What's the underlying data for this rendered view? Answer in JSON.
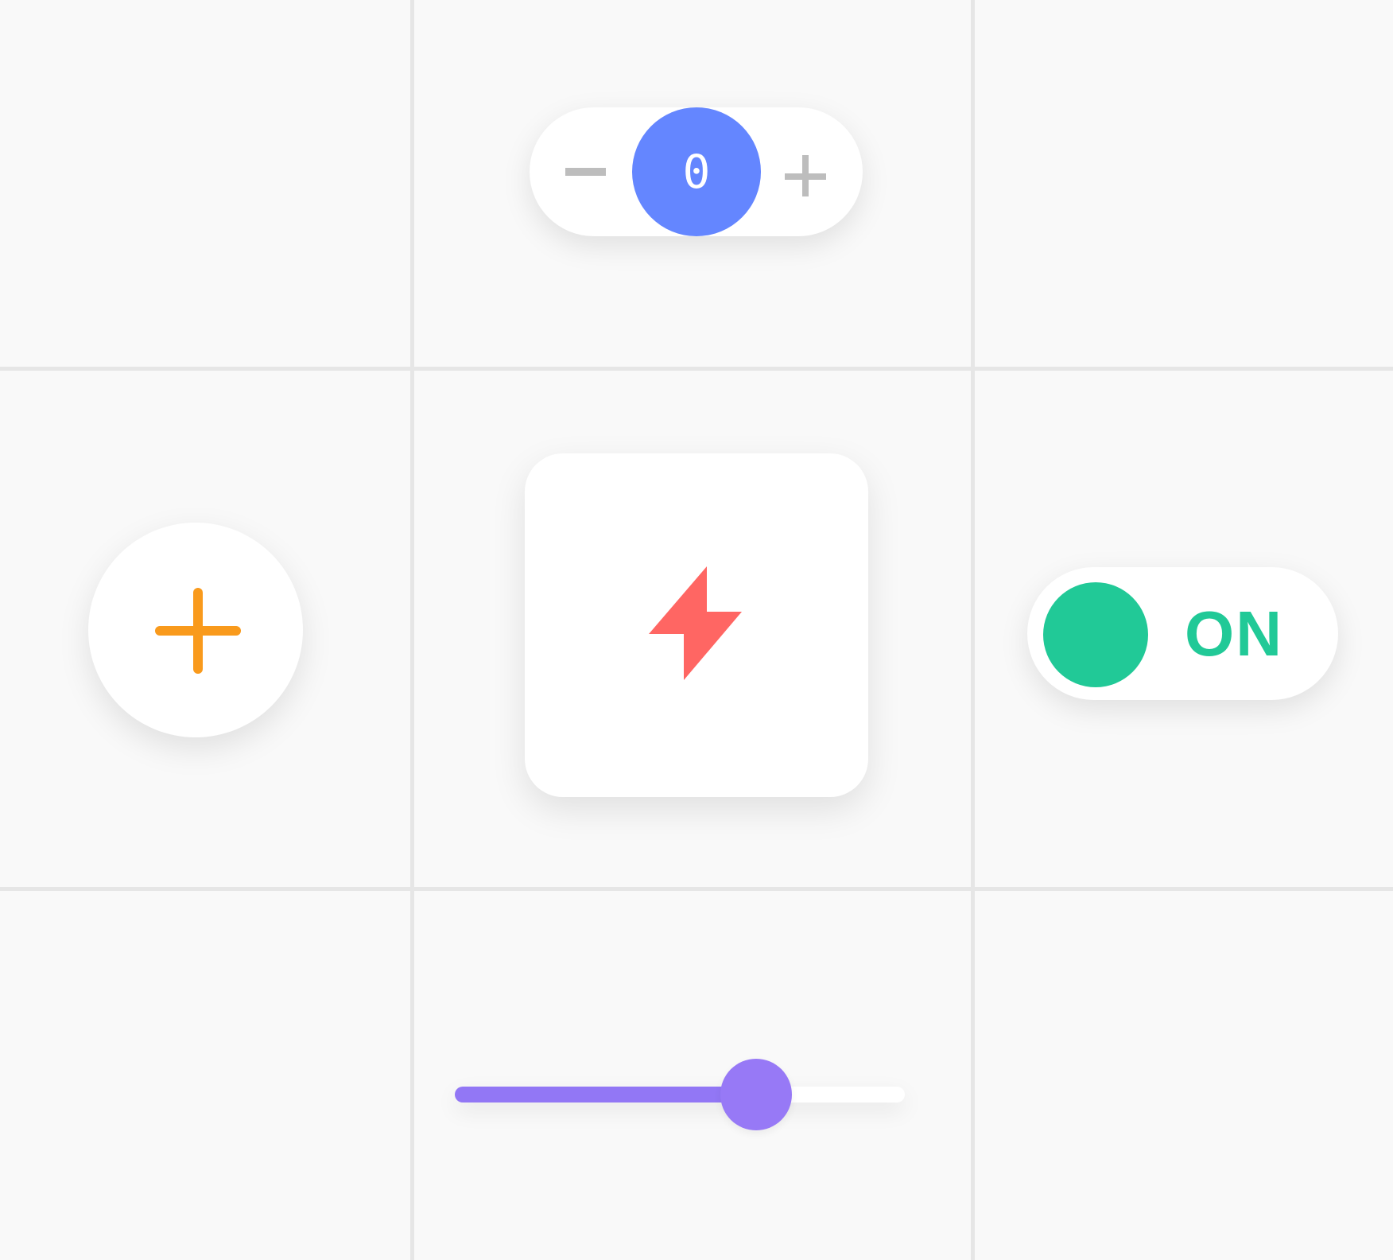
{
  "stepper": {
    "value": "0",
    "minus_icon": "minus-icon",
    "plus_icon": "plus-icon",
    "accent_color": "#6486ff"
  },
  "fab": {
    "icon": "plus-icon",
    "color": "#f99a1c"
  },
  "card": {
    "icon": "bolt-icon",
    "color": "#ff6663"
  },
  "toggle": {
    "label": "ON",
    "state": true,
    "color": "#21c997"
  },
  "slider": {
    "value_percent": 67,
    "color": "#9277f5"
  }
}
